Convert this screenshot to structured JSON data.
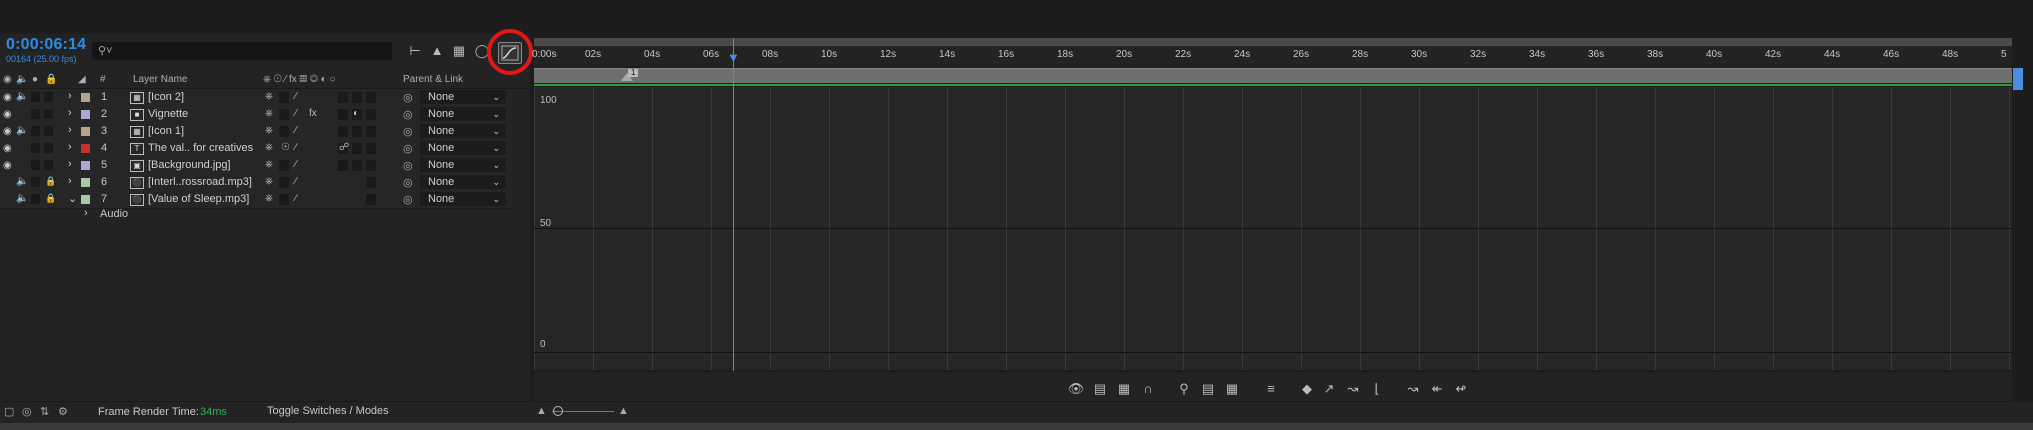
{
  "timecode": "0:00:06:14",
  "fps_info": "00164 (25.00 fps)",
  "search": {
    "placeholder": ""
  },
  "columns": {
    "layer_name": "Layer Name",
    "num": "#",
    "parent_link": "Parent & Link"
  },
  "layers": [
    {
      "num": "1",
      "name": "[Icon 2]",
      "color": "#b8a48a",
      "type": "comp",
      "parent": "None"
    },
    {
      "num": "2",
      "name": "Vignette",
      "color": "#a8a8d8",
      "type": "solid",
      "parent": "None"
    },
    {
      "num": "3",
      "name": "[Icon 1]",
      "color": "#b8a48a",
      "type": "comp",
      "parent": "None"
    },
    {
      "num": "4",
      "name": "The val.. for creatives",
      "color": "#c03434",
      "type": "text",
      "parent": "None"
    },
    {
      "num": "5",
      "name": "[Background.jpg]",
      "color": "#a8a8d8",
      "type": "footage",
      "parent": "None"
    },
    {
      "num": "6",
      "name": "[Interl..rossroad.mp3]",
      "color": "#a8c8a8",
      "type": "audio",
      "parent": "None"
    },
    {
      "num": "7",
      "name": "[Value of Sleep.mp3]",
      "color": "#a8c8a8",
      "type": "audio",
      "parent": "None"
    }
  ],
  "audio_group": "Audio",
  "ruler_ticks": [
    "0:00s",
    "02s",
    "04s",
    "06s",
    "08s",
    "10s",
    "12s",
    "14s",
    "16s",
    "18s",
    "20s",
    "22s",
    "24s",
    "26s",
    "28s",
    "30s",
    "32s",
    "34s",
    "36s",
    "38s",
    "40s",
    "42s",
    "44s",
    "46s",
    "48s",
    "5"
  ],
  "marker_label": "1",
  "graph_y_labels": [
    "100",
    "50",
    "0"
  ],
  "status": {
    "frame_render_label": "Frame Render Time:",
    "frame_render_value": "34ms",
    "toggle_label": "Toggle Switches / Modes"
  },
  "colors": {
    "accent_blue": "#2d8ceb",
    "highlight_red": "#e01818",
    "green": "#2fb34a"
  }
}
